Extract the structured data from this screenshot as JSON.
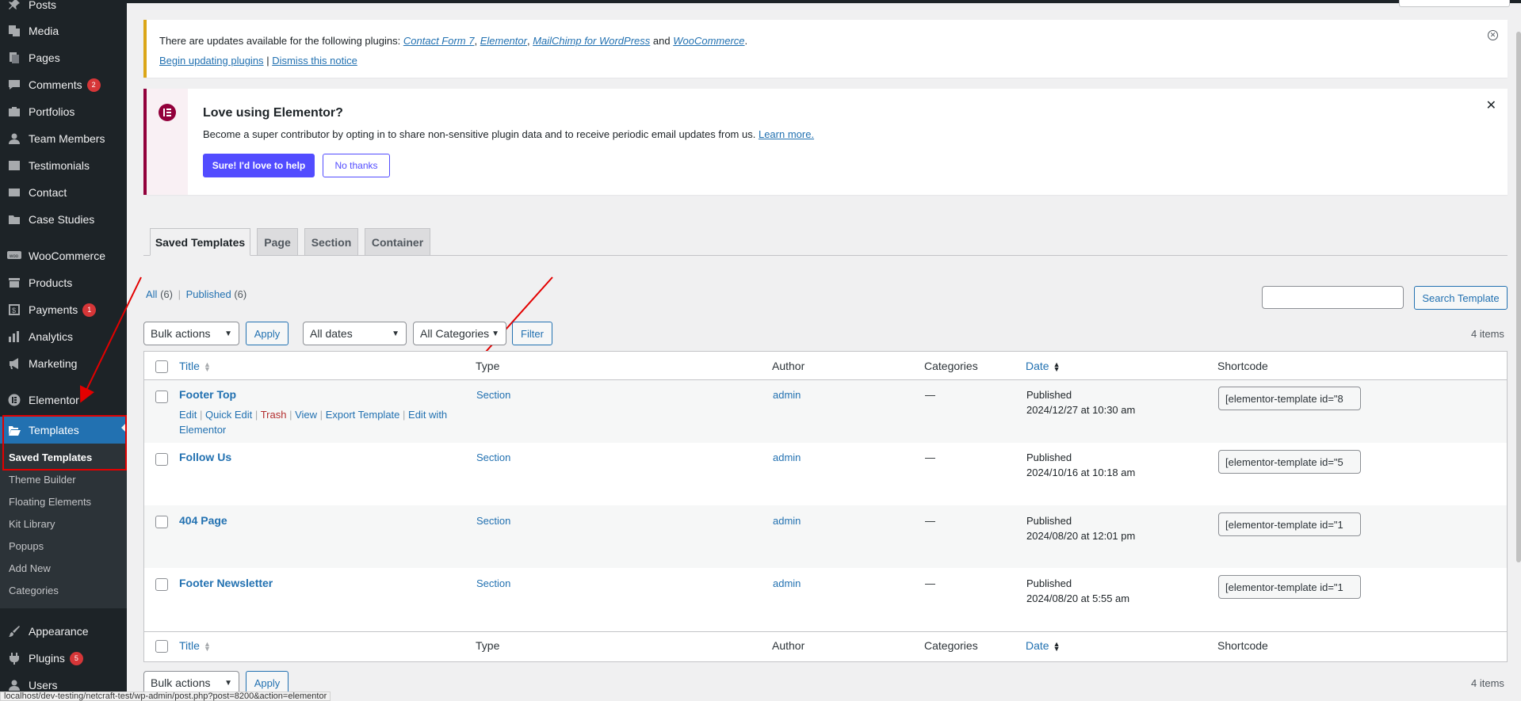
{
  "sidebar": {
    "items": [
      {
        "label": "Posts",
        "icon": "pin-icon"
      },
      {
        "label": "Media",
        "icon": "media-icon"
      },
      {
        "label": "Pages",
        "icon": "pages-icon"
      },
      {
        "label": "Comments",
        "icon": "comments-icon",
        "badge": "2"
      },
      {
        "label": "Portfolios",
        "icon": "portfolio-icon"
      },
      {
        "label": "Team Members",
        "icon": "person-icon"
      },
      {
        "label": "Testimonials",
        "icon": "testimonial-icon"
      },
      {
        "label": "Contact",
        "icon": "mail-icon"
      },
      {
        "label": "Case Studies",
        "icon": "folder-icon"
      },
      {
        "label": "WooCommerce",
        "icon": "woo-icon"
      },
      {
        "label": "Products",
        "icon": "archive-icon"
      },
      {
        "label": "Payments",
        "icon": "payment-icon",
        "badge": "1"
      },
      {
        "label": "Analytics",
        "icon": "chart-icon"
      },
      {
        "label": "Marketing",
        "icon": "megaphone-icon"
      },
      {
        "label": "Elementor",
        "icon": "elementor-icon"
      },
      {
        "label": "Templates",
        "icon": "folder-open-icon"
      },
      {
        "label": "Appearance",
        "icon": "brush-icon"
      },
      {
        "label": "Plugins",
        "icon": "plugin-icon",
        "badge": "5"
      },
      {
        "label": "Users",
        "icon": "users-icon"
      }
    ],
    "submenu": [
      "Saved Templates",
      "Theme Builder",
      "Floating Elements",
      "Kit Library",
      "Popups",
      "Add New",
      "Categories"
    ]
  },
  "update_notice": {
    "text": "There are updates available for the following plugins:",
    "plugins": [
      "Contact Form 7",
      "Elementor",
      "MailChimp for WordPress",
      "WooCommerce"
    ],
    "and": "and",
    "begin_link": "Begin updating plugins",
    "sep": "|",
    "dismiss_link": "Dismiss this notice"
  },
  "elementor_notice": {
    "title": "Love using Elementor?",
    "body": "Become a super contributor by opting in to share non-sensitive plugin data and to receive periodic email updates from us.",
    "learn_more": "Learn more.",
    "primary_btn": "Sure! I'd love to help",
    "secondary_btn": "No thanks",
    "accent": "#92003b"
  },
  "tabs": [
    "Saved Templates",
    "Page",
    "Section",
    "Container"
  ],
  "filters": {
    "all_label": "All",
    "all_count": "(6)",
    "published_label": "Published",
    "published_count": "(6)",
    "search_btn": "Search Template",
    "bulk_actions": "Bulk actions",
    "apply": "Apply",
    "dates": "All dates",
    "categories": "All Categories",
    "filter": "Filter",
    "items_count": "4 items"
  },
  "table": {
    "headers": {
      "title": "Title",
      "type": "Type",
      "author": "Author",
      "categories": "Categories",
      "date": "Date",
      "shortcode": "Shortcode"
    },
    "row_actions": {
      "edit": "Edit",
      "quick_edit": "Quick Edit",
      "trash": "Trash",
      "view": "View",
      "export": "Export Template",
      "edit_with": "Edit with Elementor"
    },
    "rows": [
      {
        "title": "Footer Top",
        "type": "Section",
        "author": "admin",
        "categories": "—",
        "status": "Published",
        "date": "2024/12/27 at 10:30 am",
        "shortcode": "[elementor-template id=\"8"
      },
      {
        "title": "Follow Us",
        "type": "Section",
        "author": "admin",
        "categories": "—",
        "status": "Published",
        "date": "2024/10/16 at 10:18 am",
        "shortcode": "[elementor-template id=\"5"
      },
      {
        "title": "404 Page",
        "type": "Section",
        "author": "admin",
        "categories": "—",
        "status": "Published",
        "date": "2024/08/20 at 12:01 pm",
        "shortcode": "[elementor-template id=\"1"
      },
      {
        "title": "Footer Newsletter",
        "type": "Section",
        "author": "admin",
        "categories": "—",
        "status": "Published",
        "date": "2024/08/20 at 5:55 am",
        "shortcode": "[elementor-template id=\"1"
      }
    ]
  },
  "status_url": "localhost/dev-testing/netcraft-test/wp-admin/post.php?post=8200&action=elementor"
}
